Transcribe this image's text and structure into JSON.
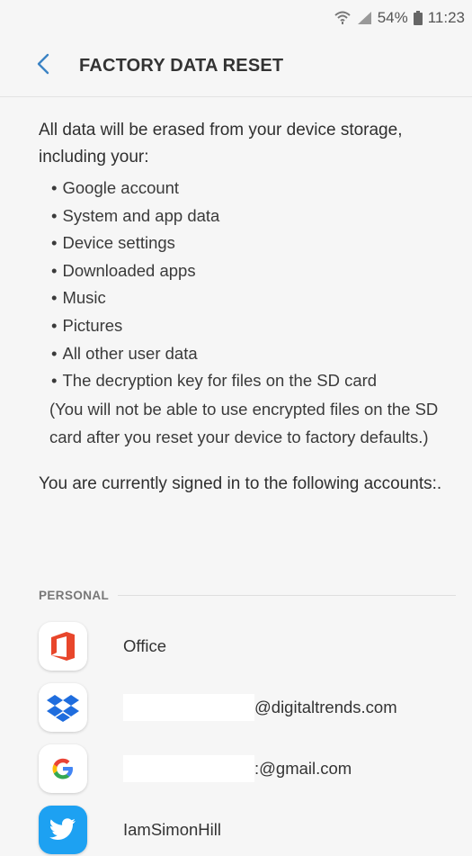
{
  "status": {
    "battery": "54%",
    "time": "11:23"
  },
  "header": {
    "title": "FACTORY DATA RESET"
  },
  "intro": "All data will be erased from your device storage, including your:",
  "items": [
    "Google account",
    "System and app data",
    "Device settings",
    "Downloaded apps",
    "Music",
    "Pictures",
    "All other user data",
    "The decryption key for files on the SD card"
  ],
  "note": "(You will not be able to use encrypted files on the SD card after you reset your device to factory defaults.)",
  "signed_in": "You are currently signed in to the following accounts:.",
  "section": {
    "label": "PERSONAL"
  },
  "accounts": [
    {
      "name": "Office",
      "icon": "office-icon"
    },
    {
      "name": "@digitaltrends.com",
      "icon": "dropbox-icon"
    },
    {
      "name": ":@gmail.com",
      "icon": "google-icon"
    },
    {
      "name": "IamSimonHill",
      "icon": "twitter-icon"
    }
  ],
  "colors": {
    "accent": "#3b83c4",
    "office": "#e8462b",
    "dropbox": "#1f6dde",
    "twitter": "#1da1f2",
    "background": "#f6f6f6"
  }
}
